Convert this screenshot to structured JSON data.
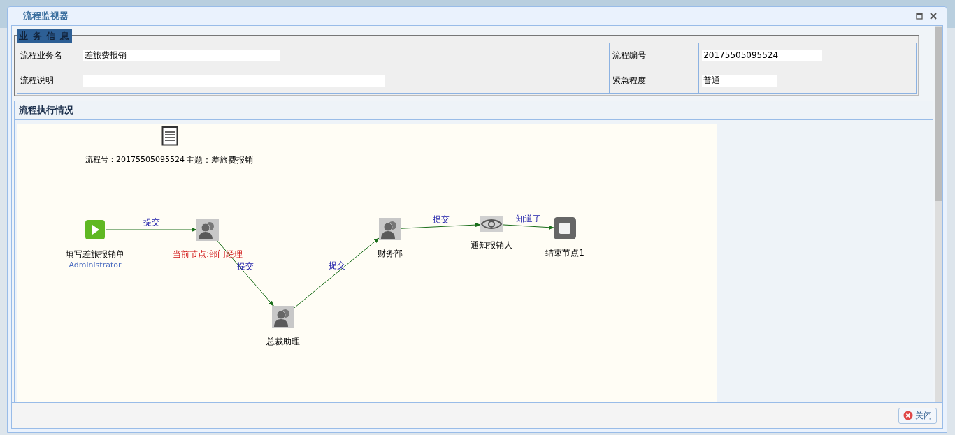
{
  "window": {
    "title": "流程监视器"
  },
  "business_info": {
    "title": "业 务 信 息",
    "fields": [
      {
        "label": "流程业务名",
        "value": "差旅费报销"
      },
      {
        "label": "流程编号",
        "value": "20175505095524"
      },
      {
        "label": "流程说明"
      },
      {
        "label": "紧急程度",
        "value": "普通"
      }
    ]
  },
  "flow": {
    "title": "流程执行情况",
    "process_no": "流程号：20175505095524",
    "subject": "主题：差旅费报销",
    "nodes": [
      {
        "kind": "start",
        "label": "填写差旅报销单",
        "user": "Administrator",
        "current": false
      },
      {
        "kind": "task",
        "label": "当前节点:部门经理",
        "current": true
      },
      {
        "kind": "task",
        "label": "总裁助理",
        "current": false
      },
      {
        "kind": "task",
        "label": "财务部",
        "current": false
      },
      {
        "kind": "notify",
        "label": "通知报销人",
        "current": false
      },
      {
        "kind": "end",
        "label": "结束节点1",
        "current": false
      }
    ],
    "edges": [
      {
        "label": "提交"
      },
      {
        "label": "提交"
      },
      {
        "label": "提交"
      },
      {
        "label": "提交"
      },
      {
        "label": "知道了"
      }
    ]
  },
  "buttons": [
    {
      "label": "关闭"
    }
  ]
}
